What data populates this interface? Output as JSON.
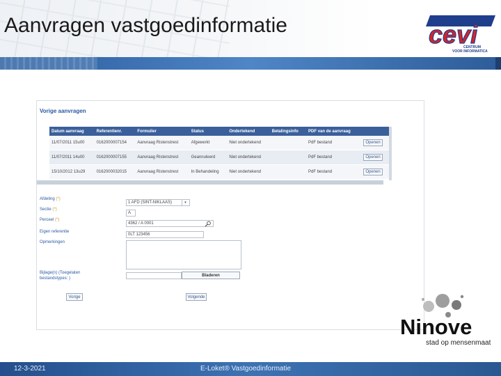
{
  "header": {
    "title": "Aanvragen vastgoedinformatie",
    "logo_letters": "cevi",
    "logo_sub1": "CENTRUM",
    "logo_sub2": "VOOR INFORMATICA"
  },
  "screenshot": {
    "section_title": "Vorige aanvragen",
    "table": {
      "columns": [
        "Datum aanvraag",
        "Referentienr.",
        "Formulier",
        "Status",
        "Ondertekend",
        "Betalingsinfo",
        "PDF van de aanvraag"
      ],
      "rows": [
        [
          "11/07/2011 15u00",
          "0162000007154",
          "Aanvraag Ristenstrest",
          "Afgewerkt",
          "Niet ondertekend",
          "",
          "PdF bestand",
          "Openen"
        ],
        [
          "11/07/2011 14u00",
          "0162000007155",
          "Aanvraag Ristenstrest",
          "Geannuleerd",
          "Niet ondertekend",
          "",
          "PdF bestand",
          "Openen"
        ],
        [
          "15/10/2012 13u29",
          "0162000032015",
          "Aanvraag Ristenstrest",
          "In Behandeling",
          "Niet ondertekend",
          "",
          "PdF bestand",
          "Openen"
        ]
      ]
    },
    "form": {
      "afdeling_label": "Afdeling",
      "sectie_label": "Sectie",
      "perceel_label": "Perceel",
      "req_mark": "(*)",
      "eigen_ref_label": "Eigen referentie",
      "opmerkingen_label": "Opmerkingen",
      "bijlagen_label": "Bijlage(n) (Toegelaten",
      "bijlagen_label2": "bestandstypes: )",
      "afdeling_value": "1 AFD (SINT-NIKLAAS)",
      "sectie_value": "A",
      "perceel_value": "4362 / A 0001",
      "eigen_ref_value": "0LT 123456",
      "browse_label": "Bladeren",
      "prev_label": "Vorige",
      "next_label": "Volgende"
    }
  },
  "ninove": {
    "word": "Ninove",
    "tagline": "stad op mensenmaat"
  },
  "footer": {
    "date": "12-3-2021",
    "name": "E-Loket® Vastgoedinformatie"
  },
  "colors": {
    "accent_blue": "#2b59a3",
    "logo_red": "#d8232a",
    "logo_navy": "#1f3e8c"
  }
}
